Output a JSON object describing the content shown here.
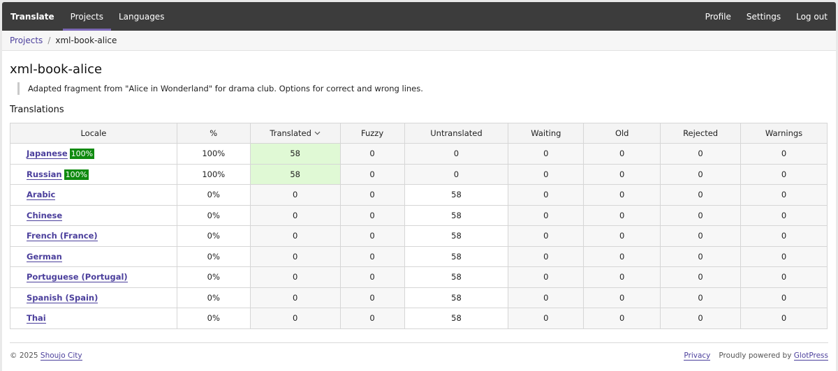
{
  "nav": {
    "brand": "Translate",
    "items": [
      {
        "label": "Projects",
        "active": true
      },
      {
        "label": "Languages",
        "active": false
      }
    ],
    "right_items": [
      {
        "label": "Profile"
      },
      {
        "label": "Settings"
      },
      {
        "label": "Log out"
      }
    ]
  },
  "breadcrumb": {
    "link": "Projects",
    "separator": "/",
    "current": "xml-book-alice"
  },
  "page": {
    "title": "xml-book-alice",
    "description": "Adapted fragment from \"Alice in Wonderland\" for drama club. Options for correct and wrong lines.",
    "section_title": "Translations"
  },
  "table": {
    "columns": [
      "Locale",
      "%",
      "Translated",
      "Fuzzy",
      "Untranslated",
      "Waiting",
      "Old",
      "Rejected",
      "Warnings"
    ],
    "sort_icon": "chevron-down-icon",
    "rows": [
      {
        "locale": "Japanese",
        "badge": "100%",
        "percent": "100%",
        "translated": "58",
        "fuzzy": "0",
        "untranslated": "0",
        "waiting": "0",
        "old": "0",
        "rejected": "0",
        "warnings": "0"
      },
      {
        "locale": "Russian",
        "badge": "100%",
        "percent": "100%",
        "translated": "58",
        "fuzzy": "0",
        "untranslated": "0",
        "waiting": "0",
        "old": "0",
        "rejected": "0",
        "warnings": "0"
      },
      {
        "locale": "Arabic",
        "badge": "",
        "percent": "0%",
        "translated": "0",
        "fuzzy": "0",
        "untranslated": "58",
        "waiting": "0",
        "old": "0",
        "rejected": "0",
        "warnings": "0"
      },
      {
        "locale": "Chinese",
        "badge": "",
        "percent": "0%",
        "translated": "0",
        "fuzzy": "0",
        "untranslated": "58",
        "waiting": "0",
        "old": "0",
        "rejected": "0",
        "warnings": "0"
      },
      {
        "locale": "French (France)",
        "badge": "",
        "percent": "0%",
        "translated": "0",
        "fuzzy": "0",
        "untranslated": "58",
        "waiting": "0",
        "old": "0",
        "rejected": "0",
        "warnings": "0"
      },
      {
        "locale": "German",
        "badge": "",
        "percent": "0%",
        "translated": "0",
        "fuzzy": "0",
        "untranslated": "58",
        "waiting": "0",
        "old": "0",
        "rejected": "0",
        "warnings": "0"
      },
      {
        "locale": "Portuguese (Portugal)",
        "badge": "",
        "percent": "0%",
        "translated": "0",
        "fuzzy": "0",
        "untranslated": "58",
        "waiting": "0",
        "old": "0",
        "rejected": "0",
        "warnings": "0"
      },
      {
        "locale": "Spanish (Spain)",
        "badge": "",
        "percent": "0%",
        "translated": "0",
        "fuzzy": "0",
        "untranslated": "58",
        "waiting": "0",
        "old": "0",
        "rejected": "0",
        "warnings": "0"
      },
      {
        "locale": "Thai",
        "badge": "",
        "percent": "0%",
        "translated": "0",
        "fuzzy": "0",
        "untranslated": "58",
        "waiting": "0",
        "old": "0",
        "rejected": "0",
        "warnings": "0"
      }
    ]
  },
  "footer": {
    "copyright": "© 2025",
    "site_link": "Shoujo City",
    "privacy": "Privacy",
    "powered_text": "Proudly powered by",
    "powered_link": "GlotPress"
  },
  "colors": {
    "nav_bg": "#3c3c3c",
    "accent": "#4b3f9c",
    "badge_green": "#0f8a0f",
    "translated_cell_green": "#e0f9d5"
  }
}
